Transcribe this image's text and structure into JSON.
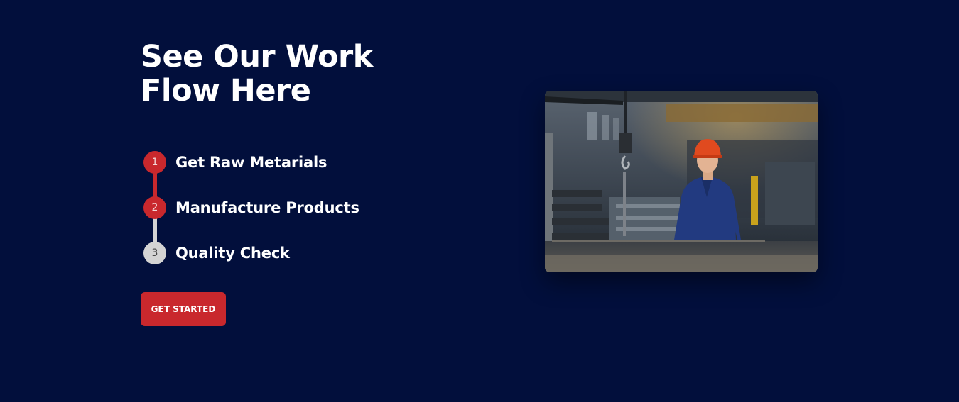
{
  "section": {
    "title_line1": "See Our Work",
    "title_line2": "Flow Here"
  },
  "steps": [
    {
      "number": "1",
      "label": "Get Raw Metarials",
      "state": "active"
    },
    {
      "number": "2",
      "label": "Manufacture Products",
      "state": "active"
    },
    {
      "number": "3",
      "label": "Quality Check",
      "state": "inactive"
    }
  ],
  "cta": {
    "label": "GET STARTED"
  },
  "image": {
    "subject": "factory-worker-photo"
  },
  "colors": {
    "background": "#020f3c",
    "accent": "#c9282d",
    "inactive": "#d4d4d4",
    "text": "#ffffff"
  }
}
